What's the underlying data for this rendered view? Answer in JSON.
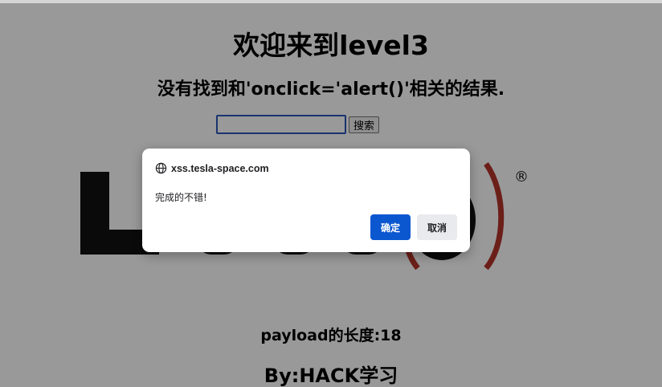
{
  "page": {
    "heading": "欢迎来到level3",
    "result_text": "没有找到和'onclick='alert()'相关的结果.",
    "search": {
      "value": "",
      "button_label": "搜索"
    },
    "logo": {
      "trademark": "®"
    },
    "payload_length": "payload的长度:18",
    "byline": "By:HACK学习"
  },
  "dialog": {
    "origin": "xss.tesla-space.com",
    "message": "完成的不错!",
    "ok_label": "确定",
    "cancel_label": "取消"
  },
  "colors": {
    "overlay": "rgba(0,0,0,0.4)",
    "primary_button": "#0b57d0",
    "logo_dark": "#111111",
    "logo_red": "#b5342b"
  }
}
